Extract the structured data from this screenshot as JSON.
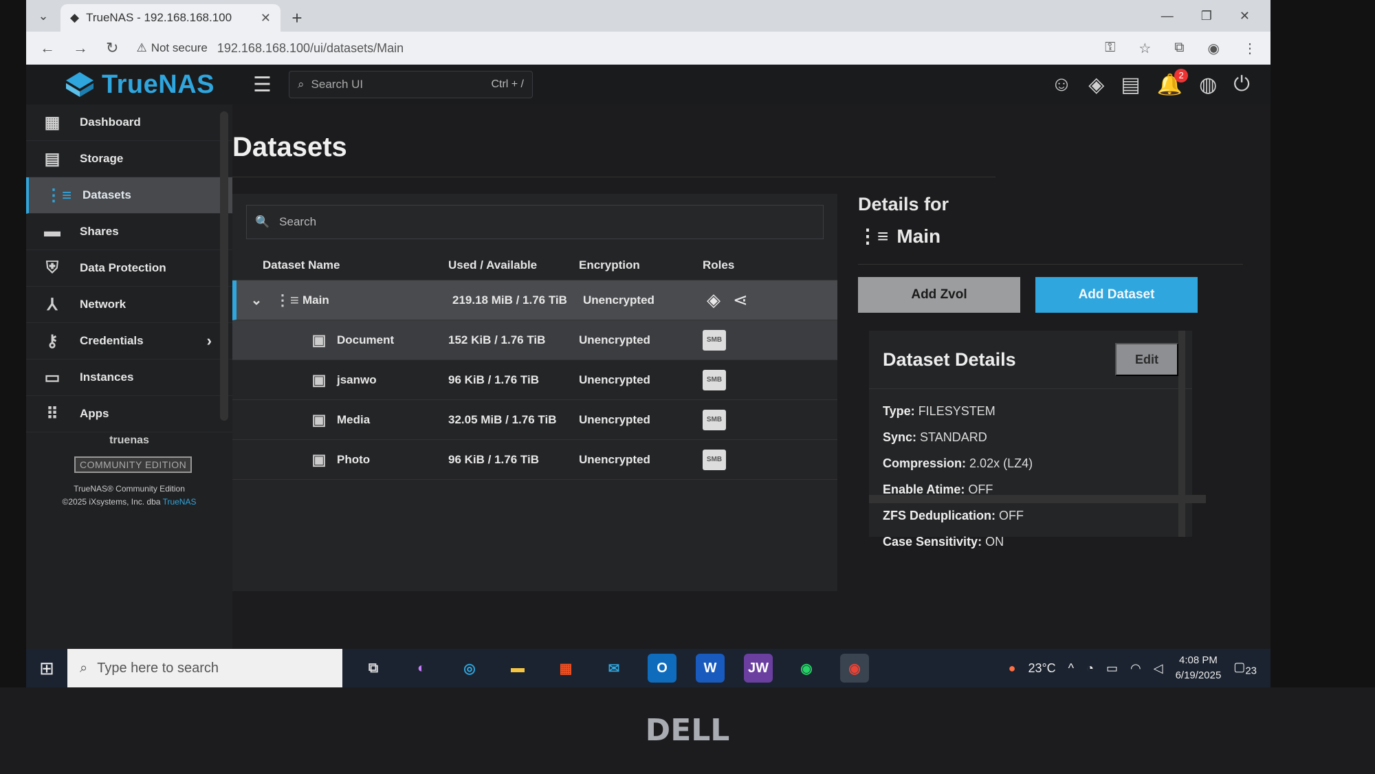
{
  "browser": {
    "tab_title": "TrueNAS - 192.168.168.100",
    "not_secure": "Not secure",
    "url": "192.168.168.100/ui/datasets/Main"
  },
  "app": {
    "brand": "TrueNAS",
    "search_placeholder": "Search UI",
    "search_shortcut": "Ctrl + /",
    "notification_count": "2"
  },
  "sidebar": {
    "items": [
      {
        "label": "Dashboard",
        "icon": "dashboard-icon"
      },
      {
        "label": "Storage",
        "icon": "storage-icon"
      },
      {
        "label": "Datasets",
        "icon": "datasets-icon",
        "active": true
      },
      {
        "label": "Shares",
        "icon": "shares-icon"
      },
      {
        "label": "Data Protection",
        "icon": "shield-icon"
      },
      {
        "label": "Network",
        "icon": "network-icon"
      },
      {
        "label": "Credentials",
        "icon": "key-icon"
      },
      {
        "label": "Instances",
        "icon": "laptop-icon"
      },
      {
        "label": "Apps",
        "icon": "apps-grid-icon"
      }
    ],
    "hostname": "truenas",
    "edition": "COMMUNITY EDITION",
    "footer_line1": "TrueNAS® Community Edition",
    "footer_line2": "©2025 iXsystems, Inc. dba ",
    "footer_link": "TrueNAS"
  },
  "page": {
    "title": "Datasets",
    "search_placeholder": "Search"
  },
  "table": {
    "headers": [
      "Dataset Name",
      "Used / Available",
      "Encryption",
      "Roles"
    ],
    "rows": [
      {
        "name": "Main",
        "used": "219.18 MiB / 1.76 TiB",
        "encryption": "Unencrypted"
      },
      {
        "name": "Document",
        "used": "152 KiB / 1.76 TiB",
        "encryption": "Unencrypted",
        "role": "SMB"
      },
      {
        "name": "jsanwo",
        "used": "96 KiB / 1.76 TiB",
        "encryption": "Unencrypted",
        "role": "SMB"
      },
      {
        "name": "Media",
        "used": "32.05 MiB / 1.76 TiB",
        "encryption": "Unencrypted",
        "role": "SMB"
      },
      {
        "name": "Photo",
        "used": "96 KiB / 1.76 TiB",
        "encryption": "Unencrypted",
        "role": "SMB"
      }
    ]
  },
  "details": {
    "heading": "Details for",
    "dataset": "Main",
    "add_zvol": "Add Zvol",
    "add_dataset": "Add Dataset",
    "card_title": "Dataset Details",
    "edit": "Edit",
    "fields": [
      {
        "k": "Type:",
        "v": "FILESYSTEM"
      },
      {
        "k": "Sync:",
        "v": "STANDARD"
      },
      {
        "k": "Compression:",
        "v": "2.02x (LZ4)"
      },
      {
        "k": "Enable Atime:",
        "v": "OFF"
      },
      {
        "k": "ZFS Deduplication:",
        "v": "OFF"
      },
      {
        "k": "Case Sensitivity:",
        "v": "ON"
      }
    ]
  },
  "taskbar": {
    "search_placeholder": "Type here to search",
    "temperature": "23°C",
    "time": "4:08 PM",
    "date": "6/19/2025",
    "notifications": "23"
  },
  "colors": {
    "accent": "#2fa6de"
  }
}
